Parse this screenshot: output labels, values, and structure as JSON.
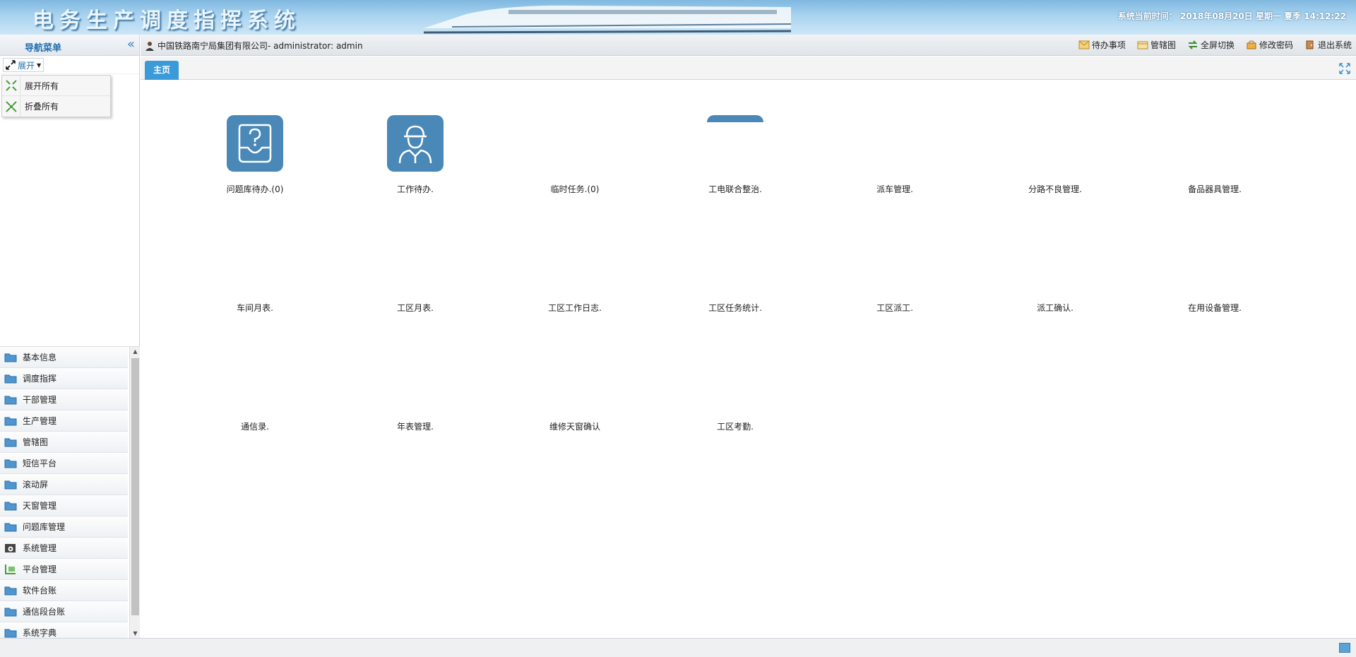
{
  "header": {
    "title": "电务生产调度指挥系统",
    "clock_label": "系统当前时间：",
    "clock_value": "2018年08月20日 星期一 夏季 14:12:22"
  },
  "sidebar": {
    "title": "导航菜单",
    "expand_label": "展开",
    "dropdown": [
      {
        "label": "展开所有"
      },
      {
        "label": "折叠所有"
      }
    ],
    "items": [
      {
        "label": "基本信息",
        "icon": "folder-icon"
      },
      {
        "label": "调度指挥",
        "icon": "folder-icon"
      },
      {
        "label": "干部管理",
        "icon": "folder-icon"
      },
      {
        "label": "生产管理",
        "icon": "folder-icon"
      },
      {
        "label": "管辖图",
        "icon": "folder-icon"
      },
      {
        "label": "短信平台",
        "icon": "folder-icon"
      },
      {
        "label": "滚动屏",
        "icon": "folder-icon"
      },
      {
        "label": "天窗管理",
        "icon": "folder-icon"
      },
      {
        "label": "问题库管理",
        "icon": "folder-icon"
      },
      {
        "label": "系统管理",
        "icon": "gear-folder-icon"
      },
      {
        "label": "平台管理",
        "icon": "platform-icon"
      },
      {
        "label": "软件台账",
        "icon": "folder-icon"
      },
      {
        "label": "通信段台账",
        "icon": "folder-icon"
      },
      {
        "label": "系统字典",
        "icon": "folder-icon"
      }
    ]
  },
  "topbar": {
    "user_text": "中国铁路南宁局集团有限公司- administrator: admin",
    "actions": [
      {
        "label": "待办事项",
        "icon": "envelope-icon"
      },
      {
        "label": "管辖图",
        "icon": "map-icon"
      },
      {
        "label": "全屏切换",
        "icon": "switch-icon"
      },
      {
        "label": "修改密码",
        "icon": "key-icon"
      },
      {
        "label": "退出系统",
        "icon": "exit-icon"
      }
    ]
  },
  "tabs": [
    {
      "label": "主页"
    }
  ],
  "tiles": [
    {
      "label": "问题库待办.(0)",
      "icon": "question-box-icon"
    },
    {
      "label": "工作待办.",
      "icon": "worker-icon"
    },
    {
      "label": "临时任务.(0)",
      "icon": ""
    },
    {
      "label": "工电联合整治.",
      "icon": "partial-icon"
    },
    {
      "label": "派车管理.",
      "icon": ""
    },
    {
      "label": "分路不良管理.",
      "icon": ""
    },
    {
      "label": "备品器具管理.",
      "icon": ""
    },
    {
      "label": "车间月表.",
      "icon": ""
    },
    {
      "label": "工区月表.",
      "icon": ""
    },
    {
      "label": "工区工作日志.",
      "icon": ""
    },
    {
      "label": "工区任务统计.",
      "icon": ""
    },
    {
      "label": "工区派工.",
      "icon": ""
    },
    {
      "label": "派工确认.",
      "icon": ""
    },
    {
      "label": "在用设备管理.",
      "icon": ""
    },
    {
      "label": "通信录.",
      "icon": ""
    },
    {
      "label": "年表管理.",
      "icon": ""
    },
    {
      "label": "维修天窗确认",
      "icon": ""
    },
    {
      "label": "工区考勤.",
      "icon": ""
    }
  ],
  "colors": {
    "accent": "#3b9ad8",
    "tile_icon": "#4a88b8",
    "nav_title": "#1e6fb2"
  }
}
